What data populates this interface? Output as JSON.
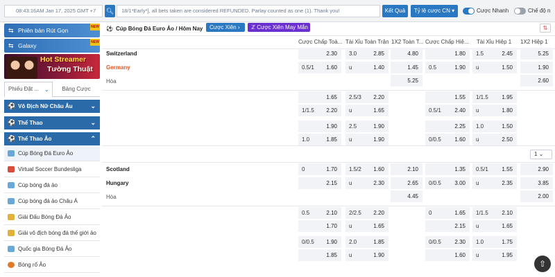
{
  "header": {
    "clock": "08:43:16AM Jan 17, 2025 GMT +7",
    "announcement": "18/1*Early*], all bets taken are considered REFUNDED. Parlay counted as one (1). Thank you!",
    "results_label": "Kết Quả",
    "odds_type_label": "Tỷ lệ cược CN",
    "quick_bet_label": "Cược Nhanh",
    "quick_bet_on": true,
    "mode_label": "Chế độ n",
    "mode_on": false
  },
  "sidebar": {
    "promo1": "Phiên bản Rút Gọn",
    "promo2": "Galaxy",
    "banner_line1": "Hot Streamer",
    "banner_line2": "Tường Thuật",
    "tab_active": "Phiếu Đặt ...",
    "tab_other": "Bảng Cược",
    "sections": [
      "Vô Địch Nữ Châu Âu",
      "Thể Thao",
      "Thể Thao Ảo"
    ],
    "subitems": [
      "Cúp Bóng Đá Euro Ảo",
      "Virtual Soccer Bundesliga",
      "Cúp bóng đá ảo",
      "Cúp bóng đá ảo Châu Á",
      "Giải Đấu Bóng Đá Ảo",
      "Giải vô địch bóng đá thế giới ảo",
      "Quốc gia Bóng Đá Ảo",
      "Bóng rổ Ảo"
    ]
  },
  "main": {
    "breadcrumb": "Cúp Bóng Đá Euro Ảo / Hôm Nay",
    "chip_parlay": "Cược Xiên",
    "chip_lucky": "Cược Xiên May Mắn",
    "headers": [
      "Cược Chấp Toà...",
      "Tài Xỉu Toàn Trận",
      "1X2 Toàn T...",
      "Cược Chấp Hiệ...",
      "Tài Xỉu Hiệp 1",
      "1X2 Hiệp 1"
    ],
    "pager": "1",
    "match1": {
      "home": "Switzerland",
      "away": "Germany",
      "draw": "Hòa",
      "rows": [
        [
          [
            "",
            "2.30"
          ],
          [
            "3.0",
            "2.85"
          ],
          [
            "",
            "4.80"
          ],
          [
            "",
            "1.80"
          ],
          [
            "1.5",
            "2.45"
          ],
          [
            "",
            "5.25"
          ]
        ],
        [
          [
            "0.5/1",
            "1.60"
          ],
          [
            "u",
            "1.40"
          ],
          [
            "",
            "1.45"
          ],
          [
            "0.5",
            "1.90"
          ],
          [
            "u",
            "1.50"
          ],
          [
            "",
            "1.90"
          ]
        ],
        [
          null,
          null,
          [
            "",
            "5.25"
          ],
          null,
          null,
          [
            "",
            "2.60"
          ]
        ],
        [
          [
            "",
            "1.65"
          ],
          [
            "2.5/3",
            "2.20"
          ],
          null,
          [
            "",
            "1.55"
          ],
          [
            "1/1.5",
            "1.95"
          ],
          null
        ],
        [
          [
            "1/1.5",
            "2.20"
          ],
          [
            "u",
            "1.65"
          ],
          null,
          [
            "0.5/1",
            "2.40"
          ],
          [
            "u",
            "1.80"
          ],
          null
        ],
        [
          [
            "",
            "1.90"
          ],
          [
            "2.5",
            "1.90"
          ],
          null,
          [
            "",
            "2.25"
          ],
          [
            "1.0",
            "1.50"
          ],
          null
        ],
        [
          [
            "1.0",
            "1.85"
          ],
          [
            "u",
            "1.90"
          ],
          null,
          [
            "0/0.5",
            "1.60"
          ],
          [
            "u",
            "2.50"
          ],
          null
        ]
      ]
    },
    "match2": {
      "home": "Scotland",
      "away": "Hungary",
      "draw": "Hòa",
      "rows": [
        [
          [
            "0",
            "1.70"
          ],
          [
            "1.5/2",
            "1.60"
          ],
          [
            "",
            "2.10"
          ],
          [
            "",
            "1.35"
          ],
          [
            "0.5/1",
            "1.55"
          ],
          [
            "",
            "2.90"
          ]
        ],
        [
          [
            "",
            "2.15"
          ],
          [
            "u",
            "2.30"
          ],
          [
            "",
            "2.65"
          ],
          [
            "0/0.5",
            "3.00"
          ],
          [
            "u",
            "2.35"
          ],
          [
            "",
            "3.85"
          ]
        ],
        [
          null,
          null,
          [
            "",
            "4.45"
          ],
          null,
          null,
          [
            "",
            "2.00"
          ]
        ],
        [
          [
            "0.5",
            "2.10"
          ],
          [
            "2/2.5",
            "2.20"
          ],
          null,
          [
            "0",
            "1.65"
          ],
          [
            "1/1.5",
            "2.10"
          ],
          null
        ],
        [
          [
            "",
            "1.70"
          ],
          [
            "u",
            "1.65"
          ],
          null,
          [
            "",
            "2.15"
          ],
          [
            "u",
            "1.65"
          ],
          null
        ],
        [
          [
            "0/0.5",
            "1.90"
          ],
          [
            "2.0",
            "1.85"
          ],
          null,
          [
            "0/0.5",
            "2.30"
          ],
          [
            "1.0",
            "1.75"
          ],
          null
        ],
        [
          [
            "",
            "1.85"
          ],
          [
            "u",
            "1.90"
          ],
          null,
          [
            "",
            "1.60"
          ],
          [
            "u",
            "1.95"
          ],
          null
        ]
      ]
    }
  }
}
